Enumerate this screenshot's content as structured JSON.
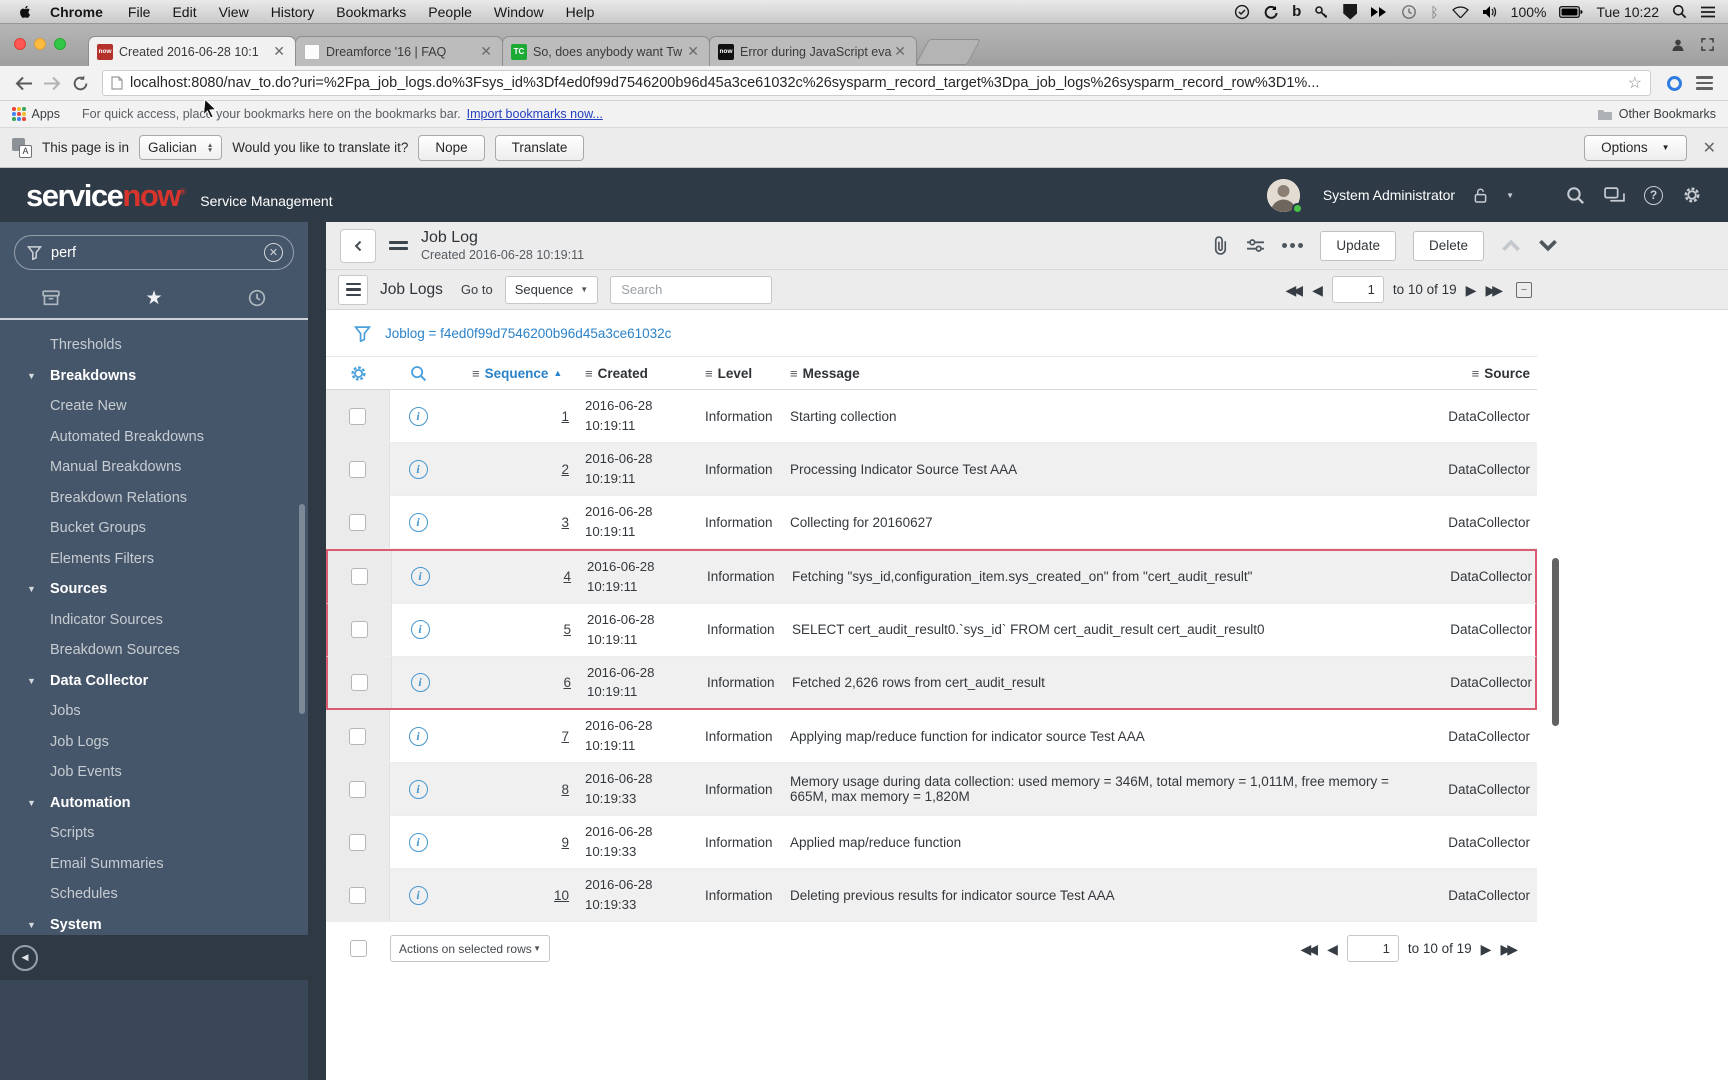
{
  "menubar": {
    "menus": [
      {
        "label": "Chrome",
        "bold": true
      },
      {
        "label": "File"
      },
      {
        "label": "Edit"
      },
      {
        "label": "View"
      },
      {
        "label": "History"
      },
      {
        "label": "Bookmarks"
      },
      {
        "label": "People"
      },
      {
        "label": "Window"
      },
      {
        "label": "Help"
      }
    ],
    "battery": "100%",
    "clock": "Tue 10:22"
  },
  "browser": {
    "tabs": [
      {
        "title": "Created 2016-06-28 10:1",
        "favicon_class": "fav-now-red",
        "favicon_text": "now",
        "active": true
      },
      {
        "title": "Dreamforce '16 | FAQ",
        "favicon_class": "fav-page",
        "favicon_text": ""
      },
      {
        "title": "So, does anybody want Tw",
        "favicon_class": "fav-tc",
        "favicon_text": "TC"
      },
      {
        "title": "Error during JavaScript eva",
        "favicon_class": "fav-now-black",
        "favicon_text": "now"
      }
    ],
    "url": "localhost:8080/nav_to.do?uri=%2Fpa_job_logs.do%3Fsys_id%3Df4ed0f99d7546200b96d45a3ce61032c%26sysparm_record_target%3Dpa_job_logs%26sysparm_record_row%3D1%...",
    "bookmarks": {
      "apps_label": "Apps",
      "hint": "For quick access, place your bookmarks here on the bookmarks bar.",
      "import_link": "Import bookmarks now...",
      "other_label": "Other Bookmarks"
    },
    "translate": {
      "prefix": "This page is in",
      "language": "Galician",
      "question": "Would you like to translate it?",
      "nope_label": "Nope",
      "translate_label": "Translate",
      "options_label": "Options"
    }
  },
  "app": {
    "header": {
      "logo_service": "service",
      "logo_now": "now",
      "product": "Service Management",
      "user": "System Administrator"
    },
    "sidebar": {
      "filter_value": "perf",
      "items": [
        {
          "label": "Thresholds"
        },
        {
          "label": "Breakdowns",
          "section": true
        },
        {
          "label": "Create New"
        },
        {
          "label": "Automated Breakdowns"
        },
        {
          "label": "Manual Breakdowns"
        },
        {
          "label": "Breakdown Relations"
        },
        {
          "label": "Bucket Groups"
        },
        {
          "label": "Elements Filters"
        },
        {
          "label": "Sources",
          "section": true
        },
        {
          "label": "Indicator Sources"
        },
        {
          "label": "Breakdown Sources"
        },
        {
          "label": "Data Collector",
          "section": true
        },
        {
          "label": "Jobs"
        },
        {
          "label": "Job Logs"
        },
        {
          "label": "Job Events"
        },
        {
          "label": "Automation",
          "section": true
        },
        {
          "label": "Scripts"
        },
        {
          "label": "Email Summaries"
        },
        {
          "label": "Schedules"
        },
        {
          "label": "System",
          "section": true
        }
      ]
    },
    "record": {
      "title": "Job Log",
      "subtitle": "Created 2016-06-28 10:19:11",
      "update_label": "Update",
      "delete_label": "Delete"
    },
    "list": {
      "title": "Job Logs",
      "goto_label": "Go to",
      "sort_field": "Sequence",
      "search_placeholder": "Search",
      "filter_text": "Joblog = f4ed0f99d7546200b96d45a3ce61032c",
      "pagination": {
        "page": "1",
        "range": "to 10 of 19"
      },
      "columns": [
        "Sequence",
        "Created",
        "Level",
        "Message",
        "Source"
      ],
      "actions_label": "Actions on selected rows",
      "rows": [
        {
          "seq": "1",
          "date": "2016-06-28",
          "time": "10:19:11",
          "level": "Information",
          "message": "Starting collection",
          "source": "DataCollector"
        },
        {
          "seq": "2",
          "date": "2016-06-28",
          "time": "10:19:11",
          "level": "Information",
          "message": "Processing Indicator Source Test AAA",
          "source": "DataCollector",
          "stripe": true
        },
        {
          "seq": "3",
          "date": "2016-06-28",
          "time": "10:19:11",
          "level": "Information",
          "message": "Collecting for 20160627",
          "source": "DataCollector"
        },
        {
          "seq": "4",
          "date": "2016-06-28",
          "time": "10:19:11",
          "level": "Information",
          "message": "Fetching \"sys_id,configuration_item.sys_created_on\" from \"cert_audit_result\"",
          "source": "DataCollector",
          "stripe": true,
          "box": true,
          "box_top": true
        },
        {
          "seq": "5",
          "date": "2016-06-28",
          "time": "10:19:11",
          "level": "Information",
          "message": "SELECT cert_audit_result0.`sys_id` FROM cert_audit_result cert_audit_result0",
          "source": "DataCollector",
          "box": true
        },
        {
          "seq": "6",
          "date": "2016-06-28",
          "time": "10:19:11",
          "level": "Information",
          "message": "Fetched 2,626 rows from cert_audit_result",
          "source": "DataCollector",
          "stripe": true,
          "box": true,
          "box_bottom": true
        },
        {
          "seq": "7",
          "date": "2016-06-28",
          "time": "10:19:11",
          "level": "Information",
          "message": "Applying map/reduce function for indicator source Test AAA",
          "source": "DataCollector"
        },
        {
          "seq": "8",
          "date": "2016-06-28",
          "time": "10:19:33",
          "level": "Information",
          "message": "Memory usage during data collection: used memory = 346M, total memory = 1,011M, free memory = 665M, max memory = 1,820M",
          "source": "DataCollector",
          "stripe": true
        },
        {
          "seq": "9",
          "date": "2016-06-28",
          "time": "10:19:33",
          "level": "Information",
          "message": "Applied map/reduce function",
          "source": "DataCollector"
        },
        {
          "seq": "10",
          "date": "2016-06-28",
          "time": "10:19:33",
          "level": "Information",
          "message": "Deleting previous results for indicator source Test AAA",
          "source": "DataCollector",
          "stripe": true
        }
      ]
    }
  }
}
